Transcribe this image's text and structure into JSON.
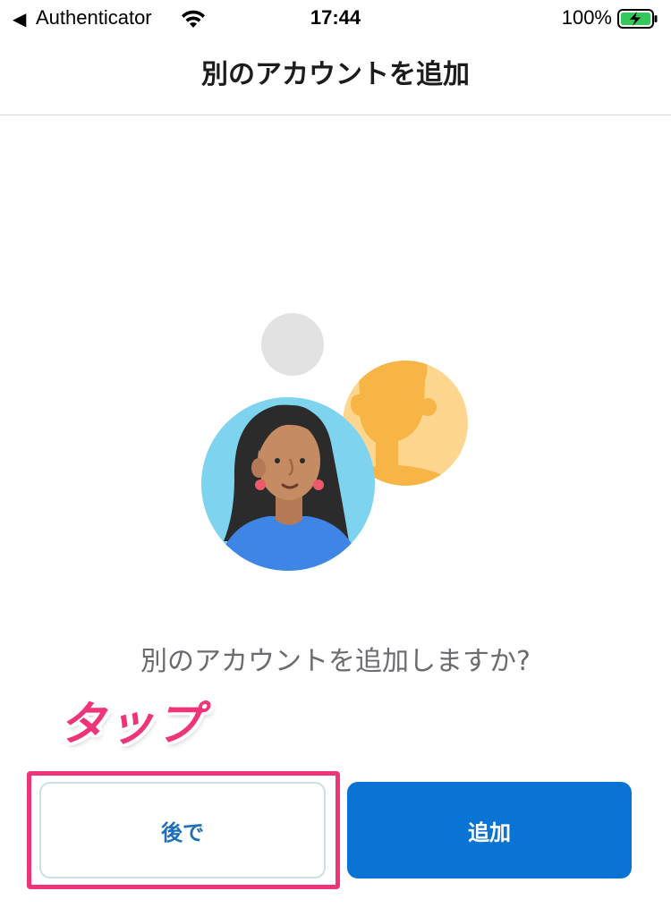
{
  "status_bar": {
    "back_caret": "◀",
    "back_app": "Authenticator",
    "time": "17:44",
    "battery_percent": "100%",
    "battery_level": 1.0,
    "charging": true
  },
  "nav": {
    "title": "別のアカウントを追加"
  },
  "illustration": {
    "icon": "accounts-illustration"
  },
  "prompt": "別のアカウントを追加しますか?",
  "annotation": {
    "label": "タップ",
    "color": "#f0347a"
  },
  "buttons": {
    "later_label": "後で",
    "add_label": "追加",
    "primary_color": "#0a74d4"
  }
}
